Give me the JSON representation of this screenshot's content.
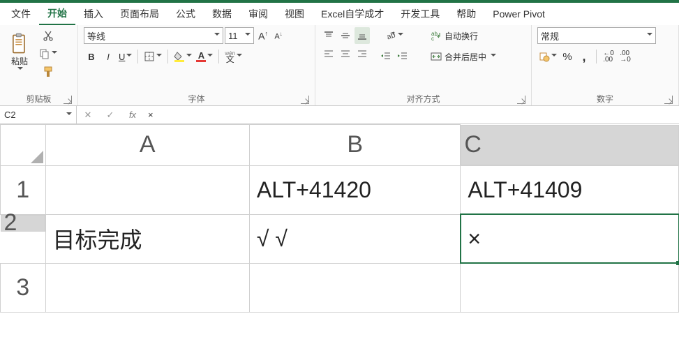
{
  "tabs": {
    "file": "文件",
    "home": "开始",
    "insert": "插入",
    "layout": "页面布局",
    "formula": "公式",
    "data": "数据",
    "review": "审阅",
    "view": "视图",
    "selfstudy": "Excel自学成才",
    "dev": "开发工具",
    "help": "帮助",
    "pivot": "Power Pivot"
  },
  "clipboard": {
    "paste": "粘贴",
    "group": "剪贴板"
  },
  "font": {
    "name": "等线",
    "size": "11",
    "group": "字体",
    "bold": "B",
    "italic": "I",
    "underline": "U",
    "wen": "wén",
    "wenchar": "文"
  },
  "align": {
    "group": "对齐方式",
    "wrap": "自动换行",
    "merge": "合并后居中"
  },
  "number": {
    "group": "数字",
    "format": "常规"
  },
  "namebox": "C2",
  "formula": "×",
  "fx": "fx",
  "cols": {
    "A": "A",
    "B": "B",
    "C": "C"
  },
  "rows": {
    "r1": "1",
    "r2": "2",
    "r3": "3"
  },
  "cells": {
    "A1": "",
    "B1": "ALT+41420",
    "C1": "ALT+41409",
    "A2": "目标完成",
    "B2": "√ √",
    "C2": "×",
    "A3": "",
    "B3": "",
    "C3": ""
  }
}
